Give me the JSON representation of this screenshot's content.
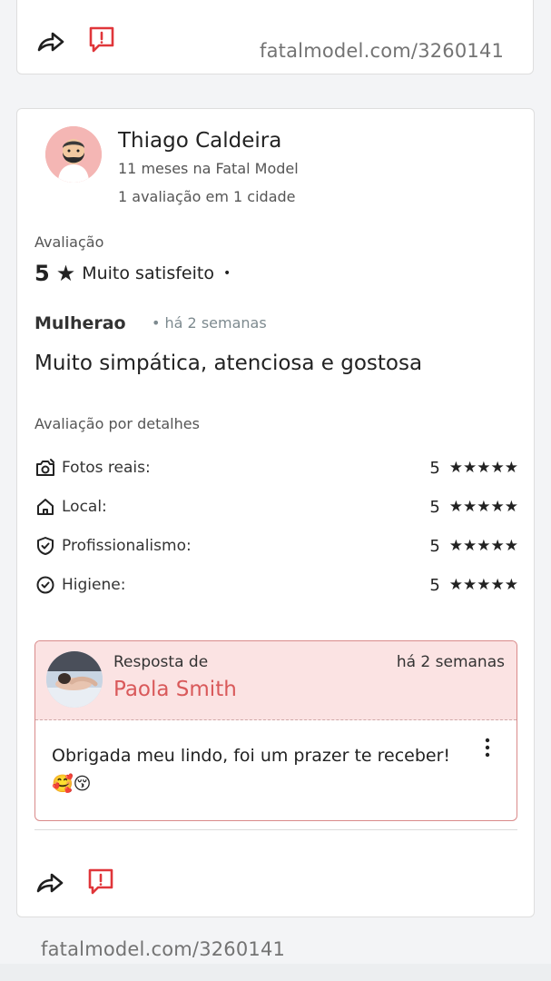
{
  "top_card": {
    "watermark": "fatalmodel.com/3260141",
    "icons": [
      "share-arrow-icon",
      "report-icon"
    ]
  },
  "review": {
    "reviewer": {
      "name": "Thiago Caldeira",
      "membership": "11 meses na Fatal Model",
      "stats": "1 avaliação em 1 cidade",
      "avatar_icon": "bearded-man-avatar-icon"
    },
    "rating_label": "Avaliação",
    "rating_value": "5",
    "rating_star": "★",
    "rating_text": "Muito satisfeito",
    "rating_dot": "•",
    "title": "Mulherao",
    "when": "• há 2 semanas",
    "body": "Muito simpática, atenciosa e gostosa",
    "details_label": "Avaliação por detalhes",
    "details": [
      {
        "icon": "camera-icon",
        "label": "Fotos reais:",
        "score": "5",
        "stars": "★★★★★"
      },
      {
        "icon": "home-icon",
        "label": "Local:",
        "score": "5",
        "stars": "★★★★★"
      },
      {
        "icon": "shield-check-icon",
        "label": "Profissionalismo:",
        "score": "5",
        "stars": "★★★★★"
      },
      {
        "icon": "check-circle-icon",
        "label": "Higiene:",
        "score": "5",
        "stars": "★★★★★"
      }
    ],
    "reply": {
      "from_label": "Resposta de",
      "name": "Paola Smith",
      "when": "há 2 semanas",
      "text": "Obrigada meu lindo, foi um prazer te receber! 🥰😚"
    },
    "icons": [
      "share-arrow-icon",
      "report-icon"
    ]
  },
  "watermark_bottom": "fatalmodel.com/3260141",
  "colors": {
    "accent": "#d9595a",
    "reply_bg": "#fbe3e3",
    "report_icon": "#e0363a"
  }
}
